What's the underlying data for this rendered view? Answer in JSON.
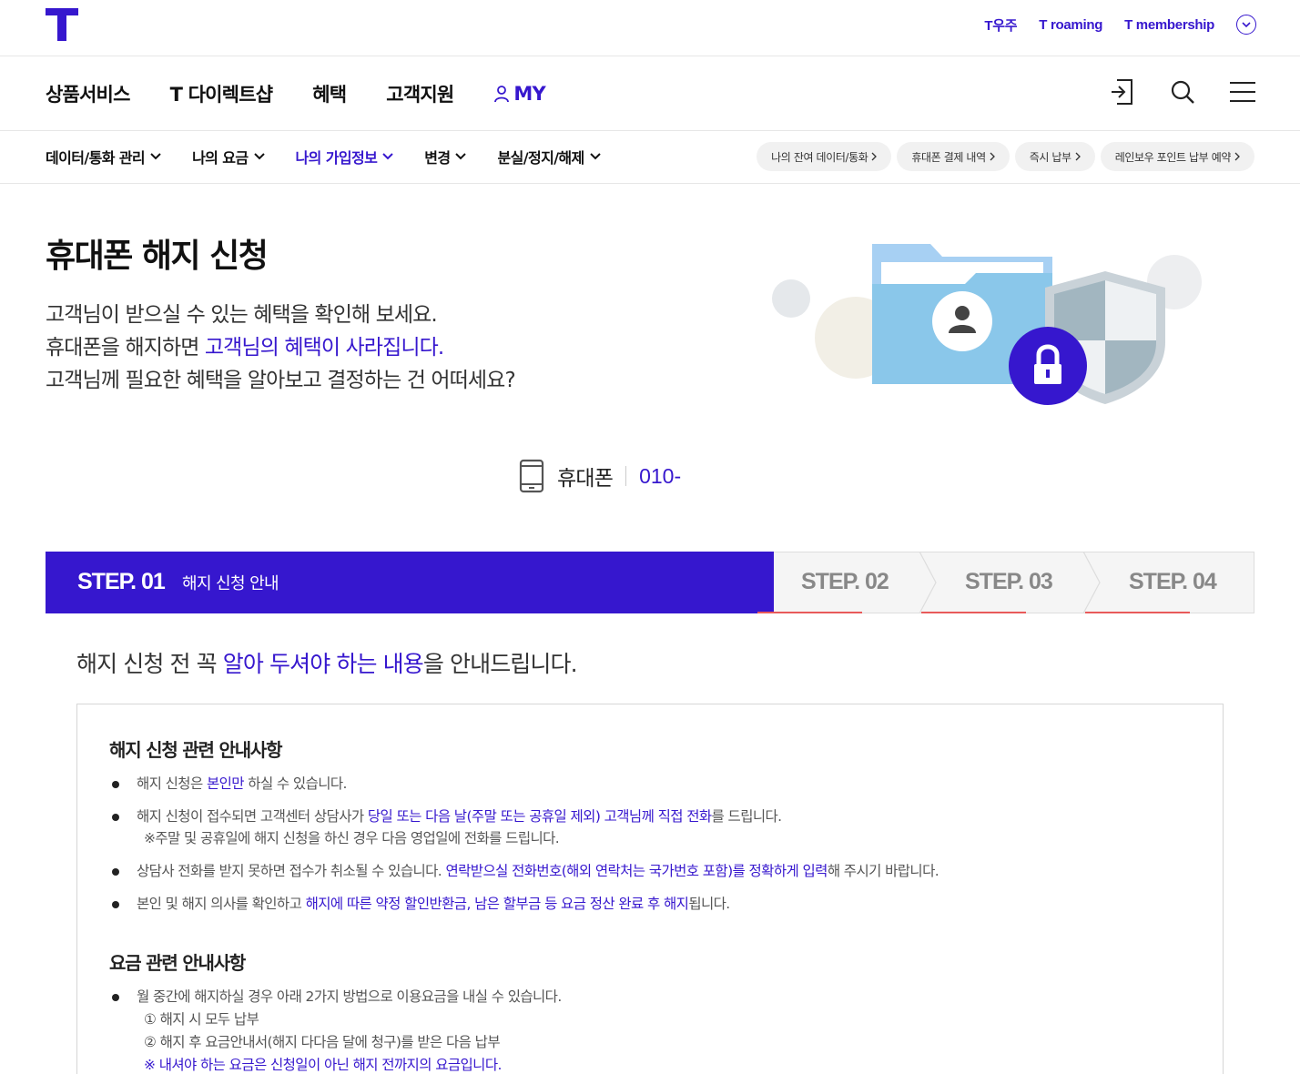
{
  "top_links": [
    "T우주",
    "T roaming",
    "T membership"
  ],
  "main_nav": [
    "상품서비스",
    "T 다이렉트샵",
    "혜택",
    "고객지원",
    "MY"
  ],
  "sub_nav": [
    "데이터/통화 관리",
    "나의 요금",
    "나의 가입정보",
    "변경",
    "분실/정지/해제"
  ],
  "quick_pills": [
    "나의 잔여 데이터/통화",
    "휴대폰 결제 내역",
    "즉시 납부",
    "레인보우 포인트 납부 예약"
  ],
  "hero": {
    "title": "휴대폰 해지 신청",
    "line1": "고객님이 받으실 수 있는 혜택을 확인해 보세요.",
    "line2_a": "휴대폰을 해지하면 ",
    "line2_b": "고객님의 혜택이 사라집니다.",
    "line3": "고객님께 필요한 혜택을 알아보고 결정하는 건 어떠세요?"
  },
  "phone": {
    "label": "휴대폰",
    "number": "010-"
  },
  "steps": [
    {
      "label": "STEP. 01",
      "text": "해지 신청 안내"
    },
    {
      "label": "STEP. 02"
    },
    {
      "label": "STEP. 03"
    },
    {
      "label": "STEP. 04"
    }
  ],
  "intro": {
    "a": "해지 신청 전 꼭 ",
    "b": "알아 두셔야 하는 내용",
    "c": "을 안내드립니다."
  },
  "section1": {
    "title": "해지 신청 관련 안내사항",
    "b1": [
      "해지 신청은 ",
      "본인만",
      " 하실 수 있습니다."
    ],
    "b2": [
      "해지 신청이 접수되면 고객센터 상담사가 ",
      "당일 또는 다음 날(주말 또는 공휴일 제외) 고객님께 직접 전화",
      "를 드립니다."
    ],
    "b2_note": "※주말 및 공휴일에 해지 신청을 하신 경우 다음 영업일에 전화를 드립니다.",
    "b3": [
      "상담사 전화를 받지 못하면 접수가 취소될 수 있습니다. ",
      "연락받으실 전화번호(해외 연락처는 국가번호 포함)를 정확하게 입력",
      "해 주시기 바랍니다."
    ],
    "b4": [
      "본인 및 해지 의사를 확인하고 ",
      "해지에 따른 약정 할인반환금, 남은 할부금 등 요금 정산 완료 후 해지",
      "됩니다."
    ]
  },
  "section2": {
    "title": "요금 관련 안내사항",
    "b1": "월 중간에 해지하실 경우 아래 2가지 방법으로 이용요금을 내실 수 있습니다.",
    "opt1": "① 해지 시 모두 납부",
    "opt2": "② 해지 후 요금안내서(해지 다다음 달에 청구)를 받은 다음 납부",
    "note": "※ 내셔야 하는 요금은 신청일이 아닌 해지 전까지의 요금입니다."
  },
  "colors": {
    "accent": "#3617ce",
    "step_underline": "#e85a5a"
  }
}
